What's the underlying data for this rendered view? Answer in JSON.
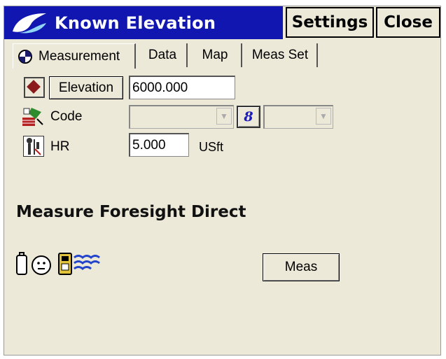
{
  "titlebar": {
    "title": "Known Elevation",
    "settings_label": "Settings",
    "close_label": "Close",
    "logo_icon": "topcon-logo-icon",
    "title_bg": "#1216b0"
  },
  "tabs": [
    {
      "label": "Measurement",
      "icon": "target-icon",
      "active": true
    },
    {
      "label": "Data"
    },
    {
      "label": "Map"
    },
    {
      "label": "Meas Set"
    }
  ],
  "point": {
    "icon": "diamond-point-icon",
    "type_button_label": "Elevation",
    "value": "6000.000"
  },
  "code": {
    "icon": "code-icon",
    "label": "Code",
    "value": "",
    "attr_icon": "string-icon",
    "attr_glyph": "8",
    "attr_value": ""
  },
  "hr": {
    "icon": "instrument-height-icon",
    "label": "HR",
    "value": "5.000",
    "unit": "USft"
  },
  "status": {
    "heading": "Measure Foresight Direct",
    "icons": [
      "battery-icon",
      "face-icon",
      "radio-link-icon"
    ]
  },
  "meas_button_label": "Meas"
}
